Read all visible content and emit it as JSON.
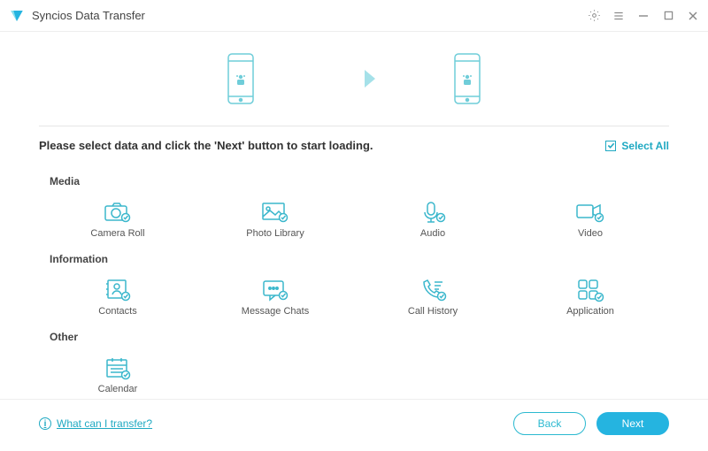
{
  "app": {
    "title": "Syncios Data Transfer"
  },
  "instructions": "Please select data and click the 'Next' button to start loading.",
  "select_all": {
    "label": "Select All",
    "checked": true
  },
  "sections": {
    "media": {
      "title": "Media",
      "items": {
        "camera_roll": "Camera Roll",
        "photo_library": "Photo Library",
        "audio": "Audio",
        "video": "Video"
      }
    },
    "information": {
      "title": "Information",
      "items": {
        "contacts": "Contacts",
        "message_chats": "Message Chats",
        "call_history": "Call History",
        "application": "Application"
      }
    },
    "other": {
      "title": "Other",
      "items": {
        "calendar": "Calendar"
      }
    }
  },
  "help": {
    "label": "What can I transfer?"
  },
  "buttons": {
    "back": "Back",
    "next": "Next"
  },
  "colors": {
    "accent": "#1fa9c2",
    "primary": "#25b4e0"
  }
}
